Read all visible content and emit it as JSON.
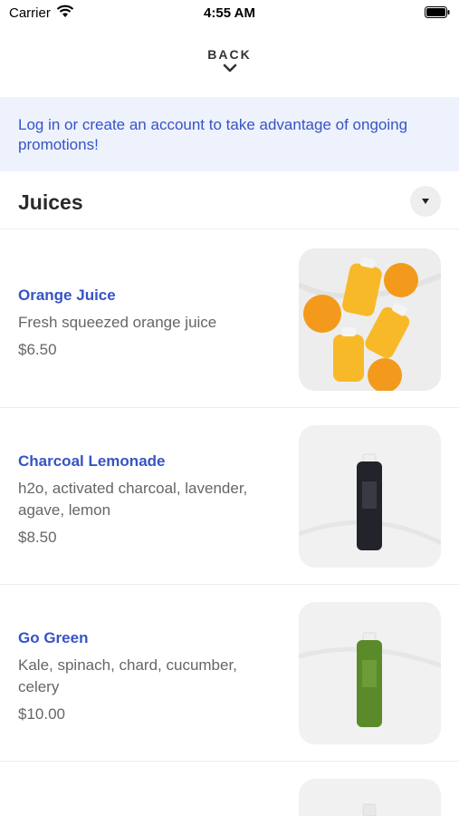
{
  "status_bar": {
    "carrier": "Carrier",
    "time": "4:55 AM"
  },
  "nav": {
    "back_label": "BACK"
  },
  "promo": {
    "text": "Log in or create an account to take advantage of ongoing promotions!"
  },
  "section": {
    "title": "Juices"
  },
  "items": [
    {
      "name": "Orange Juice",
      "description": "Fresh squeezed orange juice",
      "price": "$6.50",
      "image_icon": "orange-juice-bottles"
    },
    {
      "name": "Charcoal Lemonade",
      "description": "h2o, activated charcoal, lavender, agave, lemon",
      "price": "$8.50",
      "image_icon": "charcoal-bottle"
    },
    {
      "name": "Go Green",
      "description": "Kale, spinach, chard, cucumber, celery",
      "price": "$10.00",
      "image_icon": "green-bottle"
    }
  ],
  "colors": {
    "accent": "#3654c4",
    "promo_bg": "#eef2fd"
  }
}
